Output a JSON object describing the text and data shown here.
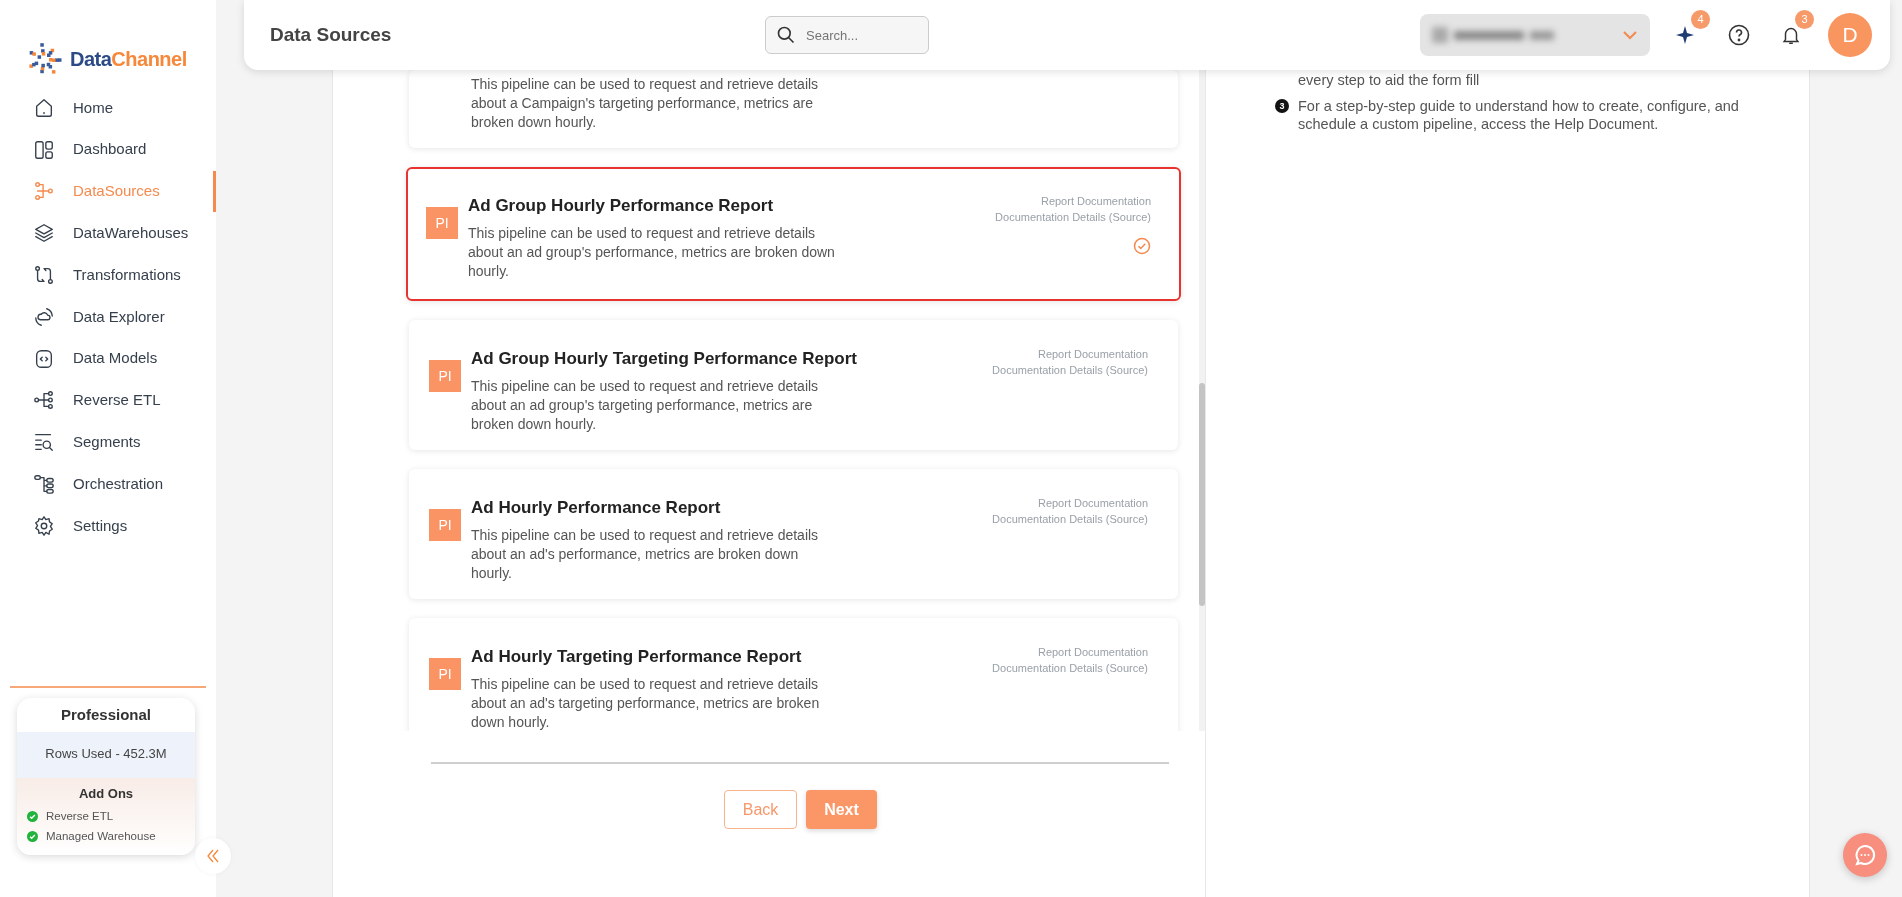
{
  "sidebar": {
    "logo": {
      "parts": [
        "Data",
        "Channel"
      ]
    },
    "items": [
      {
        "label": "Home",
        "selected": false
      },
      {
        "label": "Dashboard",
        "selected": false
      },
      {
        "label": "DataSources",
        "selected": true
      },
      {
        "label": "DataWarehouses",
        "selected": false
      },
      {
        "label": "Transformations",
        "selected": false
      },
      {
        "label": "Data Explorer",
        "selected": false
      },
      {
        "label": "Data Models",
        "selected": false
      },
      {
        "label": "Reverse ETL",
        "selected": false
      },
      {
        "label": "Segments",
        "selected": false
      },
      {
        "label": "Orchestration",
        "selected": false
      },
      {
        "label": "Settings",
        "selected": false
      }
    ],
    "plan": {
      "title": "Professional",
      "rows_used": "Rows Used - 452.3M",
      "addons_title": "Add Ons",
      "addons": [
        {
          "label": "Reverse ETL",
          "enabled": true
        },
        {
          "label": "Managed Warehouse",
          "enabled": true
        }
      ]
    }
  },
  "header": {
    "title": "Data Sources",
    "search": {
      "placeholder": "Search..."
    },
    "ai_badge": "4",
    "notifications_badge": "3",
    "avatar": "D"
  },
  "pipelines": [
    {
      "description": "This pipeline can be used to request and retrieve details about a Campaign's targeting performance, metrics are broken down hourly.",
      "selected": false
    },
    {
      "badge": "PI",
      "title": "Ad Group Hourly Performance Report",
      "description": "This pipeline can be used to request and retrieve details about an ad group's performance, metrics are broken down hourly.",
      "links": [
        "Report Documentation",
        "Documentation Details (Source)"
      ],
      "selected": true
    },
    {
      "badge": "PI",
      "title": "Ad Group Hourly Targeting Performance Report",
      "description": "This pipeline can be used to request and retrieve details about an ad group's targeting performance, metrics are broken down hourly.",
      "links": [
        "Report Documentation",
        "Documentation Details (Source)"
      ],
      "selected": false
    },
    {
      "badge": "PI",
      "title": "Ad Hourly Performance Report",
      "description": "This pipeline can be used to request and retrieve details about an ad's performance, metrics are broken down hourly.",
      "links": [
        "Report Documentation",
        "Documentation Details (Source)"
      ],
      "selected": false
    },
    {
      "badge": "PI",
      "title": "Ad Hourly Targeting Performance Report",
      "description": "This pipeline can be used to request and retrieve details about an ad's targeting performance, metrics are broken down hourly.",
      "links": [
        "Report Documentation",
        "Documentation Details (Source)"
      ],
      "selected": false
    }
  ],
  "guide": [
    {
      "text": "every step to aid the form fill"
    },
    {
      "number": "3",
      "text": "For a step-by-step guide to understand how to create, configure, and schedule a custom pipeline, access the Help Document."
    }
  ],
  "buttons": {
    "back": "Back",
    "next": "Next"
  }
}
